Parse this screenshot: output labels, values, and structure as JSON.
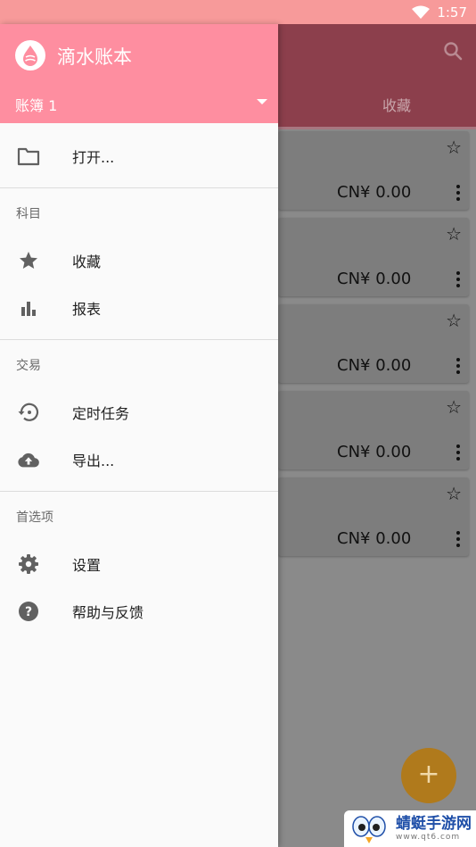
{
  "status_bar": {
    "time": "1:57"
  },
  "background": {
    "tab_label": "收藏",
    "cards": [
      {
        "amount": "CN¥ 0.00"
      },
      {
        "amount": "CN¥ 0.00"
      },
      {
        "amount": "CN¥ 0.00"
      },
      {
        "amount": "CN¥ 0.00"
      },
      {
        "amount": "CN¥ 0.00"
      }
    ],
    "fab_label": "+"
  },
  "drawer": {
    "app_title": "滴水账本",
    "book_name": "账簿 1",
    "items": {
      "open": "打开...",
      "favorites": "收藏",
      "reports": "报表",
      "scheduled": "定时任务",
      "export": "导出...",
      "settings": "设置",
      "help": "帮助与反馈"
    },
    "sections": {
      "accounts": "科目",
      "transactions": "交易",
      "preferences": "首选项"
    }
  },
  "watermark": {
    "title": "蜻蜓手游网",
    "subtitle": "www.qt6.com"
  },
  "colors": {
    "header": "#fe8ea0",
    "status_bar": "#f79a9a",
    "fab": "#f5a623"
  }
}
